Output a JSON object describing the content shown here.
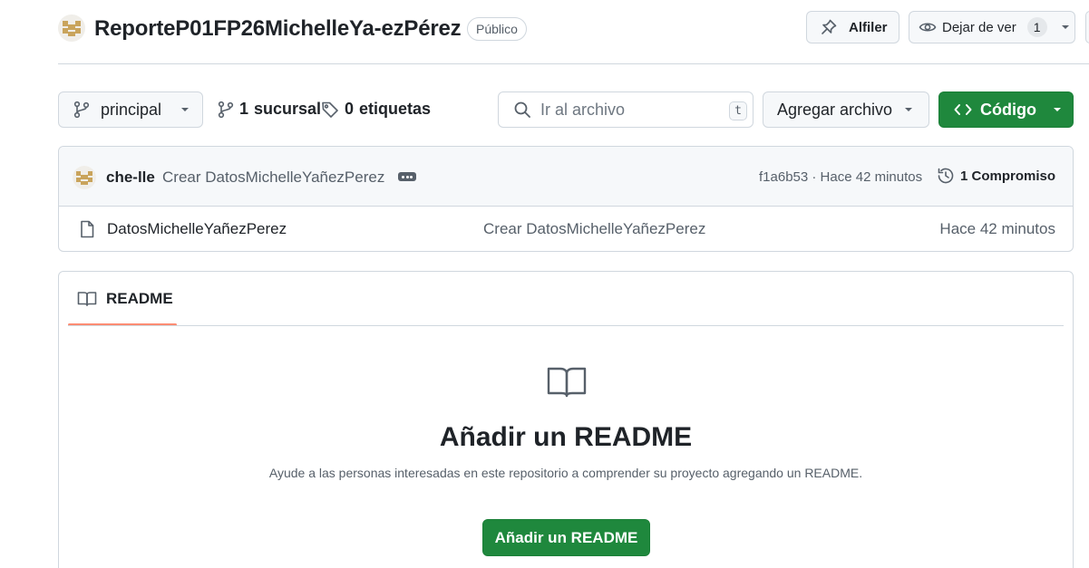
{
  "header": {
    "repo_name": "ReporteP01FP26MichelleYa-ezPérez",
    "visibility": "Público",
    "pin_label": "Alfiler",
    "watch_label": "Dejar de ver",
    "watch_count": "1",
    "avatar_icon": "pixel-identicon-icon",
    "avatar_color": "#c9a45c"
  },
  "toolbar": {
    "branch_label": "principal",
    "branches_count": "1",
    "branches_label": "sucursal",
    "tags_count": "0",
    "tags_label": "etiquetas",
    "search_placeholder": "Ir al archivo",
    "search_shortcut": "t",
    "add_file_label": "Agregar archivo",
    "code_label": "Código"
  },
  "commit": {
    "author": "che-lle",
    "message": "Crear DatosMichelleYañezPerez",
    "meta": "f1a6b53 · Hace 42 minutos",
    "commits_label": "1 Compromiso"
  },
  "files": [
    {
      "name": "DatosMichelleYañezPerez",
      "commit_message": "Crear DatosMichelleYañezPerez",
      "age": "Hace 42 minutos"
    }
  ],
  "readme": {
    "tab_label": "README",
    "heading": "Añadir un README",
    "description": "Ayude a las personas interesadas en este repositorio a comprender su proyecto agregando un README.",
    "button_label": "Añadir un README"
  },
  "colors": {
    "primary_green": "#1f883d",
    "tab_underline": "#fd8c73",
    "border": "#d0d7de"
  }
}
